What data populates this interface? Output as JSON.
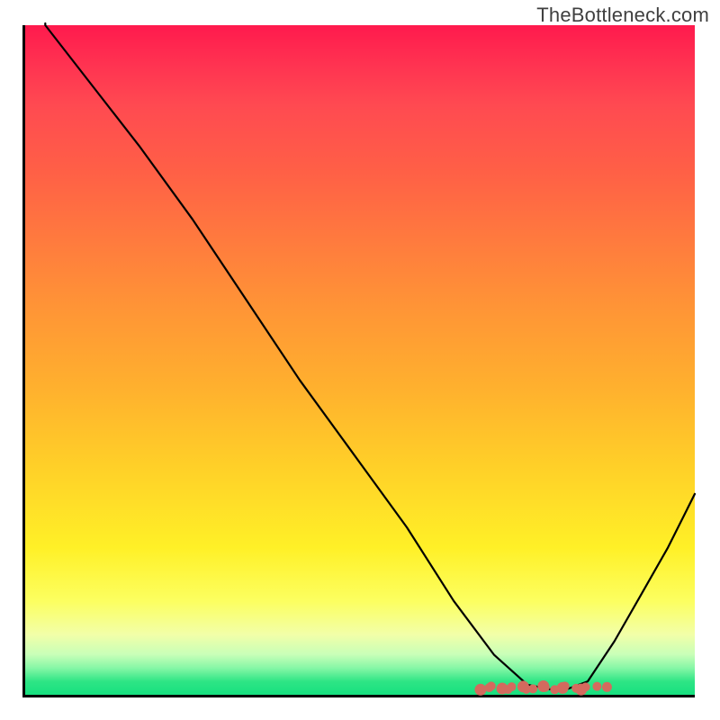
{
  "watermark": "TheBottleneck.com",
  "colors": {
    "gradient_top": "#ff1a4d",
    "gradient_mid": "#ffd028",
    "gradient_bottom": "#17e07f",
    "curve": "#000000",
    "dots": "#d46a5e",
    "axes": "#000000"
  },
  "chart_data": {
    "type": "line",
    "title": "",
    "xlabel": "",
    "ylabel": "",
    "xlim": [
      0,
      100
    ],
    "ylim": [
      0,
      100
    ],
    "series": [
      {
        "name": "bottleneck-curve",
        "x": [
          3,
          10,
          17,
          25,
          33,
          41,
          49,
          57,
          64,
          70,
          75,
          80,
          84,
          88,
          92,
          96,
          100
        ],
        "values": [
          100,
          91,
          82,
          71,
          59,
          47,
          36,
          25,
          14,
          6,
          1.5,
          0.5,
          2,
          8,
          15,
          22,
          30
        ]
      }
    ],
    "marker_region": {
      "name": "optimal-zone-dots",
      "x_start": 68,
      "x_end": 85,
      "y": 0.9
    },
    "background_gradient": {
      "direction": "vertical",
      "stops": [
        {
          "pos": 0.0,
          "color": "#ff1a4d"
        },
        {
          "pos": 0.5,
          "color": "#ffb02e"
        },
        {
          "pos": 0.8,
          "color": "#fff027"
        },
        {
          "pos": 0.95,
          "color": "#86f7a6"
        },
        {
          "pos": 1.0,
          "color": "#17e07f"
        }
      ]
    }
  }
}
